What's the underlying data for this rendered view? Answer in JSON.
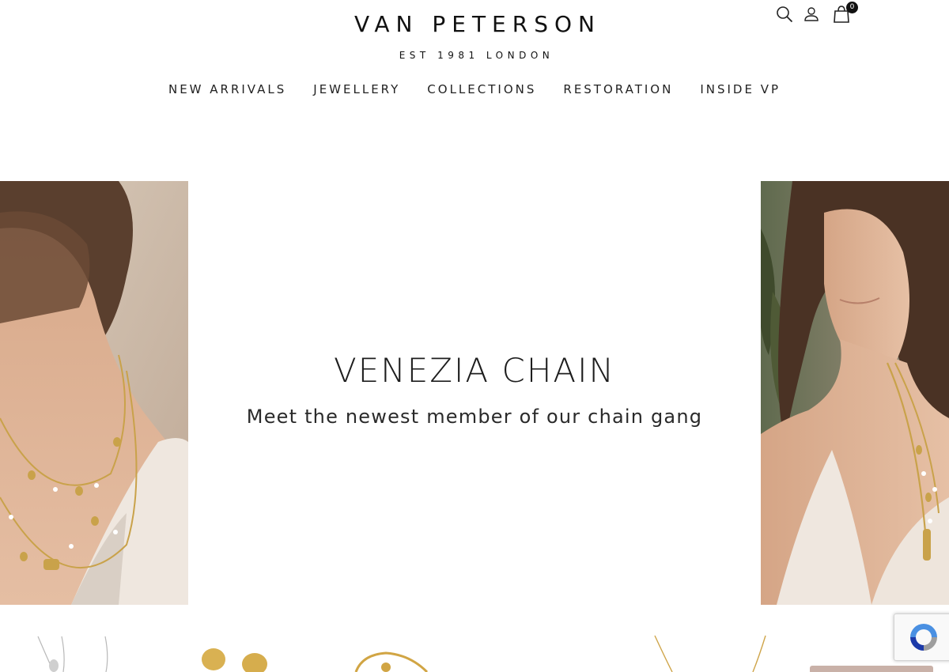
{
  "brand": {
    "name": "VAN PETERSON",
    "tagline": "EST 1981 LONDON"
  },
  "header_icons": {
    "search": "search-icon",
    "account": "user-icon",
    "cart": "shopping-bag-icon",
    "cart_count": "0"
  },
  "nav": {
    "items": [
      {
        "label": "NEW ARRIVALS"
      },
      {
        "label": "JEWELLERY"
      },
      {
        "label": "COLLECTIONS"
      },
      {
        "label": "RESTORATION"
      },
      {
        "label": "INSIDE VP"
      }
    ]
  },
  "hero": {
    "title": "VENEZIA CHAIN",
    "subtitle": "Meet the newest member of our chain gang"
  },
  "colors": {
    "text": "#1a1a1a",
    "gold": "#c9a24a",
    "skin": "#e2b89a",
    "dress": "#efe7df"
  }
}
